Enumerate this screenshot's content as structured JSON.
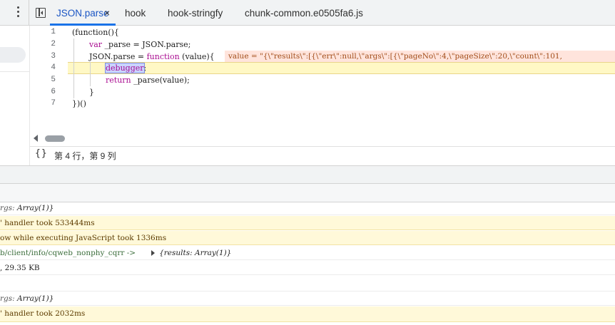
{
  "tabs": [
    {
      "label": "JSON.parse",
      "active": true
    },
    {
      "label": "hook",
      "active": false
    },
    {
      "label": "hook-stringfy",
      "active": false
    },
    {
      "label": "chunk-common.e0505fa6.js",
      "active": false
    }
  ],
  "close_glyph": "×",
  "editor": {
    "line_numbers": [
      "1",
      "2",
      "3",
      "4",
      "5",
      "6",
      "7"
    ],
    "lines": {
      "l1": "(function(){",
      "l2_var": "var",
      "l2_rest": " _parse = JSON.parse;",
      "l3_a": "JSON.parse = ",
      "l3_fn": "function",
      "l3_b": " (value){",
      "l4": "debugger",
      "l4_semi": ";",
      "l5_ret": "return",
      "l5_rest": " _parse(value);",
      "l6": "}",
      "l7": "})()"
    },
    "inline_value": "value = \"{\\\"results\\\":[{\\\"err\\\":null,\\\"args\\\":[{\\\"pageNo\\\":4,\\\"pageSize\\\":20,\\\"count\\\":101,"
  },
  "status": {
    "braces": "{}",
    "cursor_position": "第 4 行，第 9 列"
  },
  "console": {
    "rows": [
      {
        "a": "rgs: ",
        "b": "Array(1)}",
        "warn": false
      },
      {
        "text": "' handler took 533444ms",
        "warn": true
      },
      {
        "text": "ow while executing JavaScript took 1336ms",
        "warn": true
      },
      {
        "link": "b/client/info/cqweb_nonphy_cqrr ->",
        "obj_a": "{results: ",
        "obj_b": "Array(1)}"
      },
      {
        "text": ", 29.35 KB"
      },
      {
        "text": ""
      },
      {
        "a": "rgs: ",
        "b": "Array(1)}",
        "warn": false
      },
      {
        "text": "' handler took 2032ms",
        "warn": true
      }
    ]
  },
  "colors": {
    "active_tab": "#1a55c4",
    "tab_underline": "#1a73e8",
    "debug_line": "#fff8c5",
    "inline_value_bg": "#ffe4dc",
    "warning_bg": "#fff9d9"
  },
  "icons": [
    "more-vert-icon",
    "toggle-navigator-icon",
    "close-icon",
    "braces-icon",
    "scroll-left-icon",
    "expand-triangle-icon"
  ]
}
